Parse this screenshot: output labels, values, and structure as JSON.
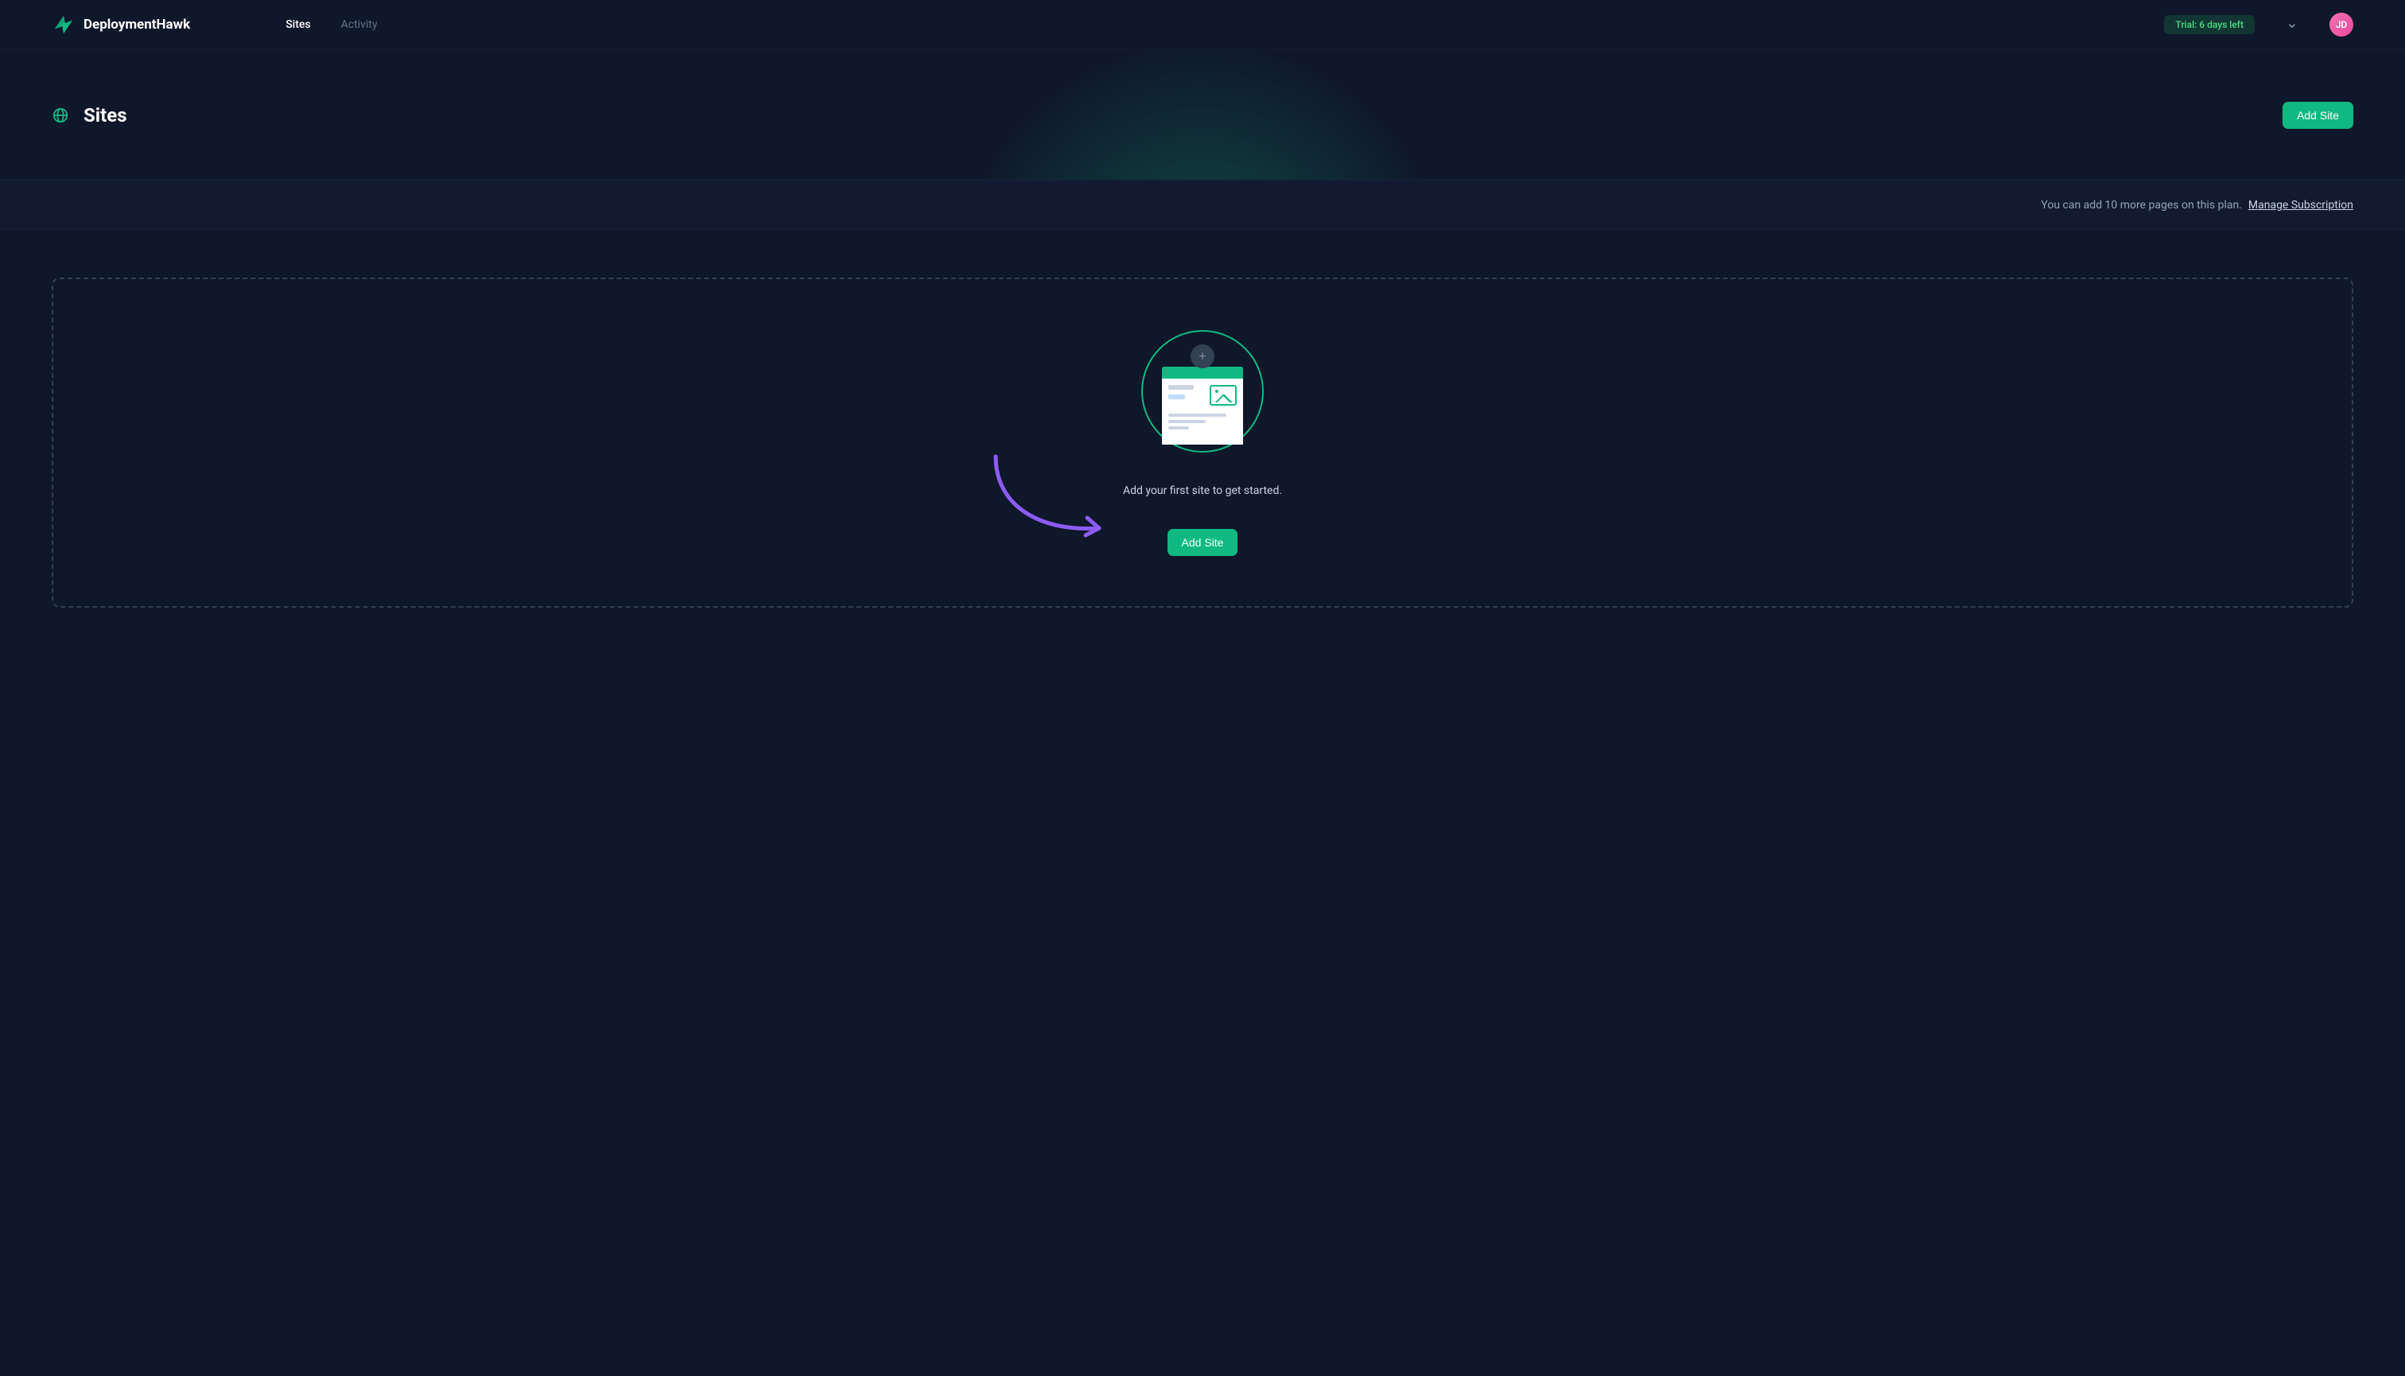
{
  "brand": {
    "name": "DeploymentHawk"
  },
  "nav": {
    "links": [
      {
        "label": "Sites",
        "active": true
      },
      {
        "label": "Activity",
        "active": false
      }
    ]
  },
  "header_right": {
    "trial_badge": "Trial: 6 days left",
    "avatar_initials": "JD"
  },
  "page": {
    "title": "Sites",
    "add_button": "Add Site"
  },
  "plan_bar": {
    "message": "You can add 10 more pages on this plan.",
    "link": "Manage Subscription"
  },
  "empty_state": {
    "message": "Add your first site to get started.",
    "cta": "Add Site"
  },
  "colors": {
    "accent": "#10b981",
    "bg": "#0f172a",
    "arrow": "#8b5cf6"
  }
}
